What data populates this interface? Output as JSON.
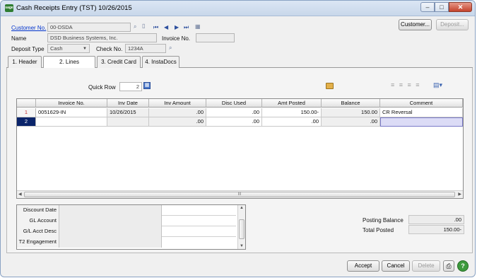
{
  "window": {
    "title": "Cash Receipts Entry (TST) 10/26/2015",
    "icon_text": "sage"
  },
  "header": {
    "customer_no_label": "Customer No.",
    "customer_no_value": "00-DSDA",
    "name_label": "Name",
    "name_value": "DSD Business Systems, Inc.",
    "invoice_no_label": "Invoice No.",
    "invoice_no_value": "",
    "deposit_type_label": "Deposit Type",
    "deposit_type_value": "Cash",
    "check_no_label": "Check No.",
    "check_no_value": "1234A",
    "customer_button": "Customer...",
    "deposit_button": "Deposit..."
  },
  "tabs": [
    {
      "label": "1. Header"
    },
    {
      "label": "2. Lines"
    },
    {
      "label": "3. Credit Card"
    },
    {
      "label": "4. InstaDocs"
    }
  ],
  "quick_row": {
    "label": "Quick Row",
    "value": "2"
  },
  "grid": {
    "columns": [
      "Invoice No.",
      "Inv Date",
      "Inv Amount",
      "Disc Used",
      "Amt Posted",
      "Balance",
      "Comment"
    ],
    "rows": [
      {
        "num": "1",
        "cells": [
          "0051629-IN",
          "10/26/2015",
          ".00",
          ".00",
          "150.00-",
          "150.00",
          "CR Reversal"
        ]
      },
      {
        "num": "2",
        "cells": [
          "",
          "",
          ".00",
          ".00",
          ".00",
          ".00",
          ""
        ]
      }
    ],
    "scroll_grip": "III"
  },
  "details": [
    {
      "label": "Discount Date"
    },
    {
      "label": "GL Account"
    },
    {
      "label": "G/L Acct Desc"
    },
    {
      "label": "T2 Engagement"
    }
  ],
  "totals": {
    "posting_balance_label": "Posting Balance",
    "posting_balance_value": ".00",
    "total_posted_label": "Total Posted",
    "total_posted_value": "150.00-"
  },
  "footer": {
    "accept": "Accept",
    "cancel": "Cancel",
    "delete": "Delete"
  },
  "colors": {
    "selected_row": "#0a246a",
    "comment_highlight": "#dcdcf6",
    "link": "#0033cc"
  }
}
